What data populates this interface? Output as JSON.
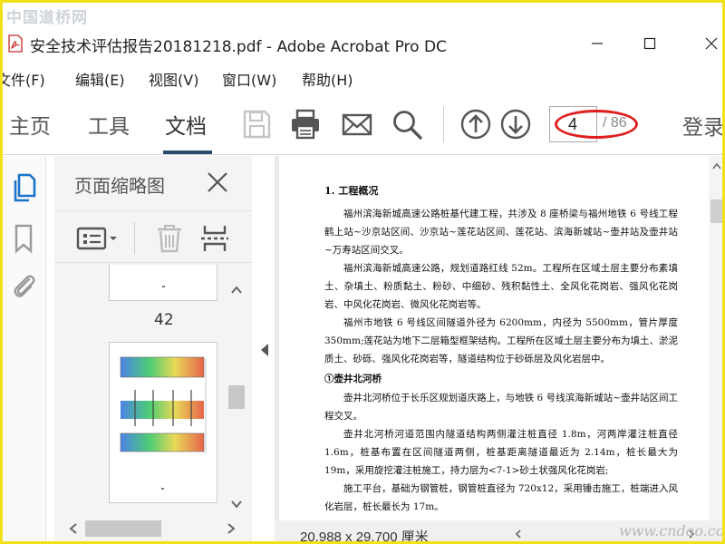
{
  "watermark_top": "中国道桥网",
  "watermark_bottom": "www.cndao.com",
  "window": {
    "title": "安全技术评估报告20181218.pdf - Adobe Acrobat Pro DC"
  },
  "menubar": {
    "items": [
      "文件(F)",
      "编辑(E)",
      "视图(V)",
      "窗口(W)",
      "帮助(H)"
    ]
  },
  "toolbar": {
    "tabs": [
      "主页",
      "工具",
      "文档"
    ],
    "active_tab": "文档",
    "current_page": "4",
    "total_pages": "/ 86",
    "login_label": "登录",
    "annotation_color": "#e02020"
  },
  "thumbnails": {
    "title": "页面缩略图",
    "visible_page_number": "42"
  },
  "document": {
    "heading": "1. 工程概况",
    "paragraphs": [
      "福州滨海新城高速公路桩基代建工程，共涉及 8 座桥梁与福州地铁 6 号线工程鹤上站~沙京站区间、沙京站~莲花站区间、莲花站、滨海新城站~壶井站及壶井站~万寿站区间交叉。",
      "福州滨海新城高速公路，规划道路红线 52m。工程所在区域土层主要分布素填土、杂填土、粉质黏土、粉砂、中细砂、残积黏性土、全风化花岗岩、强风化花岗岩、中风化花岗岩、微风化花岗岩等。",
      "福州市地铁 6 号线区间隧道外径为 6200mm，内径为 5500mm，管片厚度 350mm;莲花站为地下二层箱型框架结构。工程所在区域土层主要分布为填土、淤泥质土、砂砾、强风化花岗岩等，隧道结构位于砂砾层及风化岩层中。"
    ],
    "subheading": "①壶井北河桥",
    "paragraphs2": [
      "壶井北河桥位于长乐区规划道庆路上，与地铁 6 号线滨海新城站~壶井站区间工程交叉。",
      "壶井北河桥河道范围内隧道结构两侧灌注桩直径 1.8m，河两岸灌注桩直径 1.6m，桩基布置在区间隧道两侧，桩基距离隧道最近为 2.14m，桩长最大为 19m，采用旋挖灌注桩施工，持力层为<7-1>砂土状强风化花岗岩;",
      "施工平台，基础为钢管桩，钢管桩直径为 720x12，采用锤击施工，桩端进入风化岩层，桩长最长为 17m。"
    ],
    "page_size": "20.988 x 29.700 厘米"
  },
  "colors": {
    "frame_border": "#f2e11a",
    "accent": "#2b4a6e",
    "rail_icon_active": "#1a73c9"
  }
}
